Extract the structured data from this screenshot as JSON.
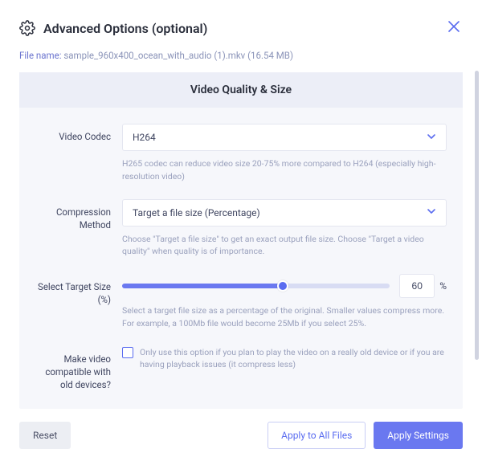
{
  "header": {
    "title": "Advanced Options (optional)"
  },
  "file": {
    "label": "File name:",
    "name": "sample_960x400_ocean_with_audio (1).mkv",
    "size": "(16.54 MB)"
  },
  "panel": {
    "title": "Video Quality & Size",
    "codec": {
      "label": "Video Codec",
      "value": "H264",
      "hint": "H265 codec can reduce video size 20-75% more compared to H264 (especially high-resolution video)"
    },
    "compression": {
      "label": "Compression Method",
      "value": "Target a file size (Percentage)",
      "hint": "Choose \"Target a file size\" to get an exact output file size. Choose \"Target a video quality\" when quality is of importance."
    },
    "target": {
      "label": "Select Target Size (%)",
      "value": "60",
      "percent_sign": "%",
      "hint": "Select a target file size as a percentage of the original. Smaller values compress more. For example, a 100Mb file would become 25Mb if you select 25%."
    },
    "compat": {
      "label": "Make video compatible with old devices?",
      "checked": false,
      "hint": "Only use this option if you plan to play the video on a really old device or if you are having playback issues (it compress less)"
    }
  },
  "footer": {
    "reset": "Reset",
    "apply_all": "Apply to All Files",
    "apply": "Apply Settings"
  }
}
